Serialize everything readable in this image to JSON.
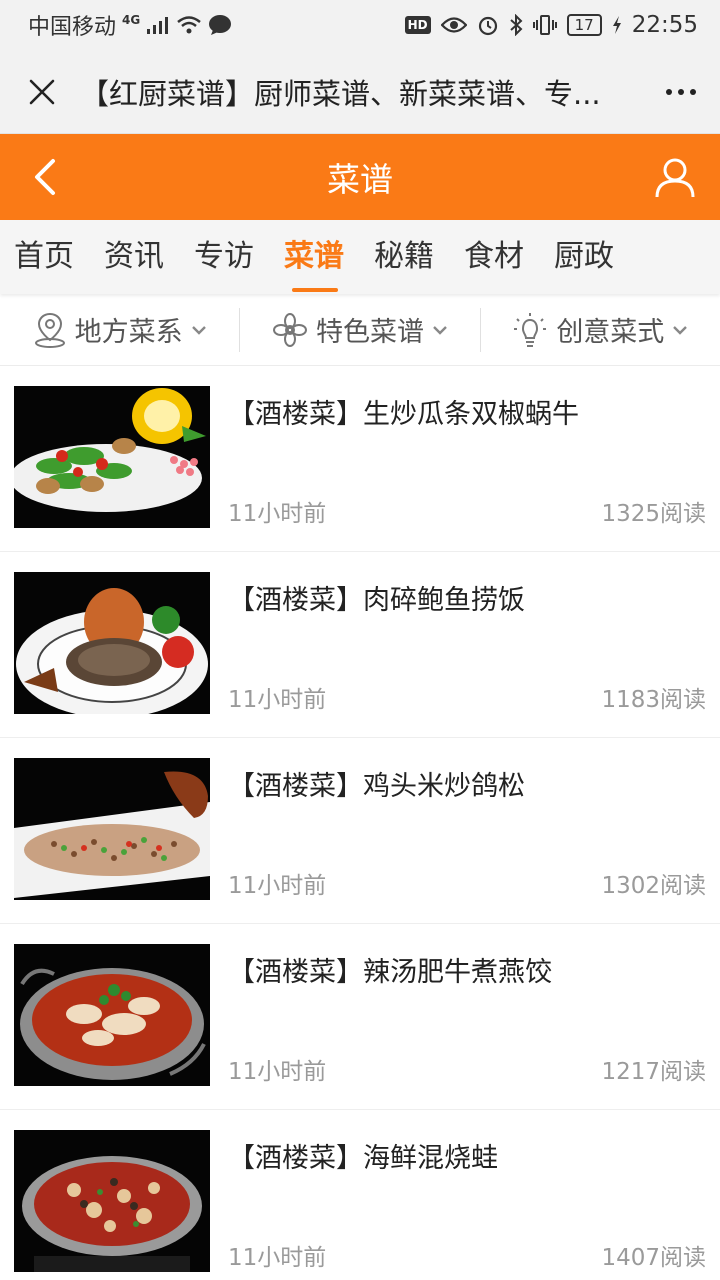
{
  "status_bar": {
    "carrier": "中国移动",
    "network": "4G",
    "battery": "17",
    "time": "22:55"
  },
  "title_bar": {
    "title": "【红厨菜谱】厨师菜谱、新菜菜谱、专..."
  },
  "header": {
    "title": "菜谱",
    "accent_color": "#fa7a16"
  },
  "tabs": [
    {
      "label": "首页"
    },
    {
      "label": "资讯"
    },
    {
      "label": "专访"
    },
    {
      "label": "菜谱"
    },
    {
      "label": "秘籍"
    },
    {
      "label": "食材"
    },
    {
      "label": "厨政"
    }
  ],
  "active_tab": "菜谱",
  "filters": [
    {
      "label": "地方菜系",
      "icon": "location-pin-icon"
    },
    {
      "label": "特色菜谱",
      "icon": "flower-icon"
    },
    {
      "label": "创意菜式",
      "icon": "lightbulb-icon"
    }
  ],
  "articles": [
    {
      "title": "【酒楼菜】生炒瓜条双椒蜗牛",
      "time": "11小时前",
      "reads": "1325阅读"
    },
    {
      "title": "【酒楼菜】肉碎鲍鱼捞饭",
      "time": "11小时前",
      "reads": "1183阅读"
    },
    {
      "title": "【酒楼菜】鸡头米炒鸽松",
      "time": "11小时前",
      "reads": "1302阅读"
    },
    {
      "title": "【酒楼菜】辣汤肥牛煮燕饺",
      "time": "11小时前",
      "reads": "1217阅读"
    },
    {
      "title": "【酒楼菜】海鲜混烧蛙",
      "time": "11小时前",
      "reads": "1407阅读"
    }
  ]
}
